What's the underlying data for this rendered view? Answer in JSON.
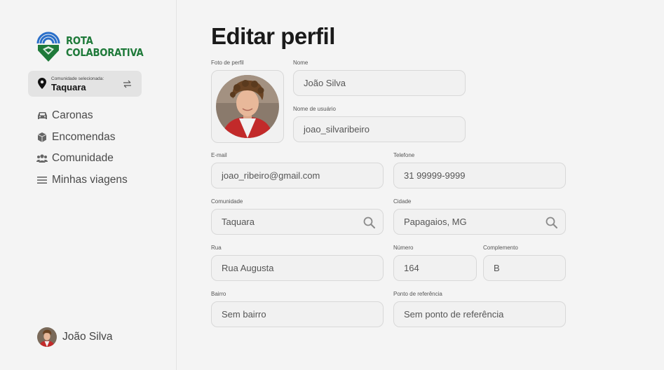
{
  "app": {
    "logo_line1": "ROTA",
    "logo_line2": "COLABORATIVA",
    "brand_color": "#1f7a3a"
  },
  "sidebar": {
    "community_caption": "Comunidade selecionada:",
    "community_name": "Taquara",
    "nav": [
      {
        "label": "Caronas",
        "icon": "car-icon"
      },
      {
        "label": "Encomendas",
        "icon": "package-icon"
      },
      {
        "label": "Comunidade",
        "icon": "users-icon"
      },
      {
        "label": "Minhas viagens",
        "icon": "list-icon"
      }
    ],
    "user_name": "João Silva"
  },
  "page": {
    "title": "Editar perfil"
  },
  "form": {
    "photo_label": "Foto de perfil",
    "name_label": "Nome",
    "name_value": "João Silva",
    "username_label": "Nome de usuário",
    "username_value": "joao_silvaribeiro",
    "email_label": "E-mail",
    "email_value": "joao_ribeiro@gmail.com",
    "phone_label": "Telefone",
    "phone_value": "31 99999-9999",
    "community_label": "Comunidade",
    "community_value": "Taquara",
    "city_label": "Cidade",
    "city_value": "Papagaios, MG",
    "street_label": "Rua",
    "street_value": "Rua Augusta",
    "number_label": "Número",
    "number_value": "164",
    "complement_label": "Complemento",
    "complement_value": "B",
    "district_label": "Bairro",
    "district_placeholder": "Sem bairro",
    "reference_label": "Ponto de referência",
    "reference_placeholder": "Sem ponto de referência"
  }
}
